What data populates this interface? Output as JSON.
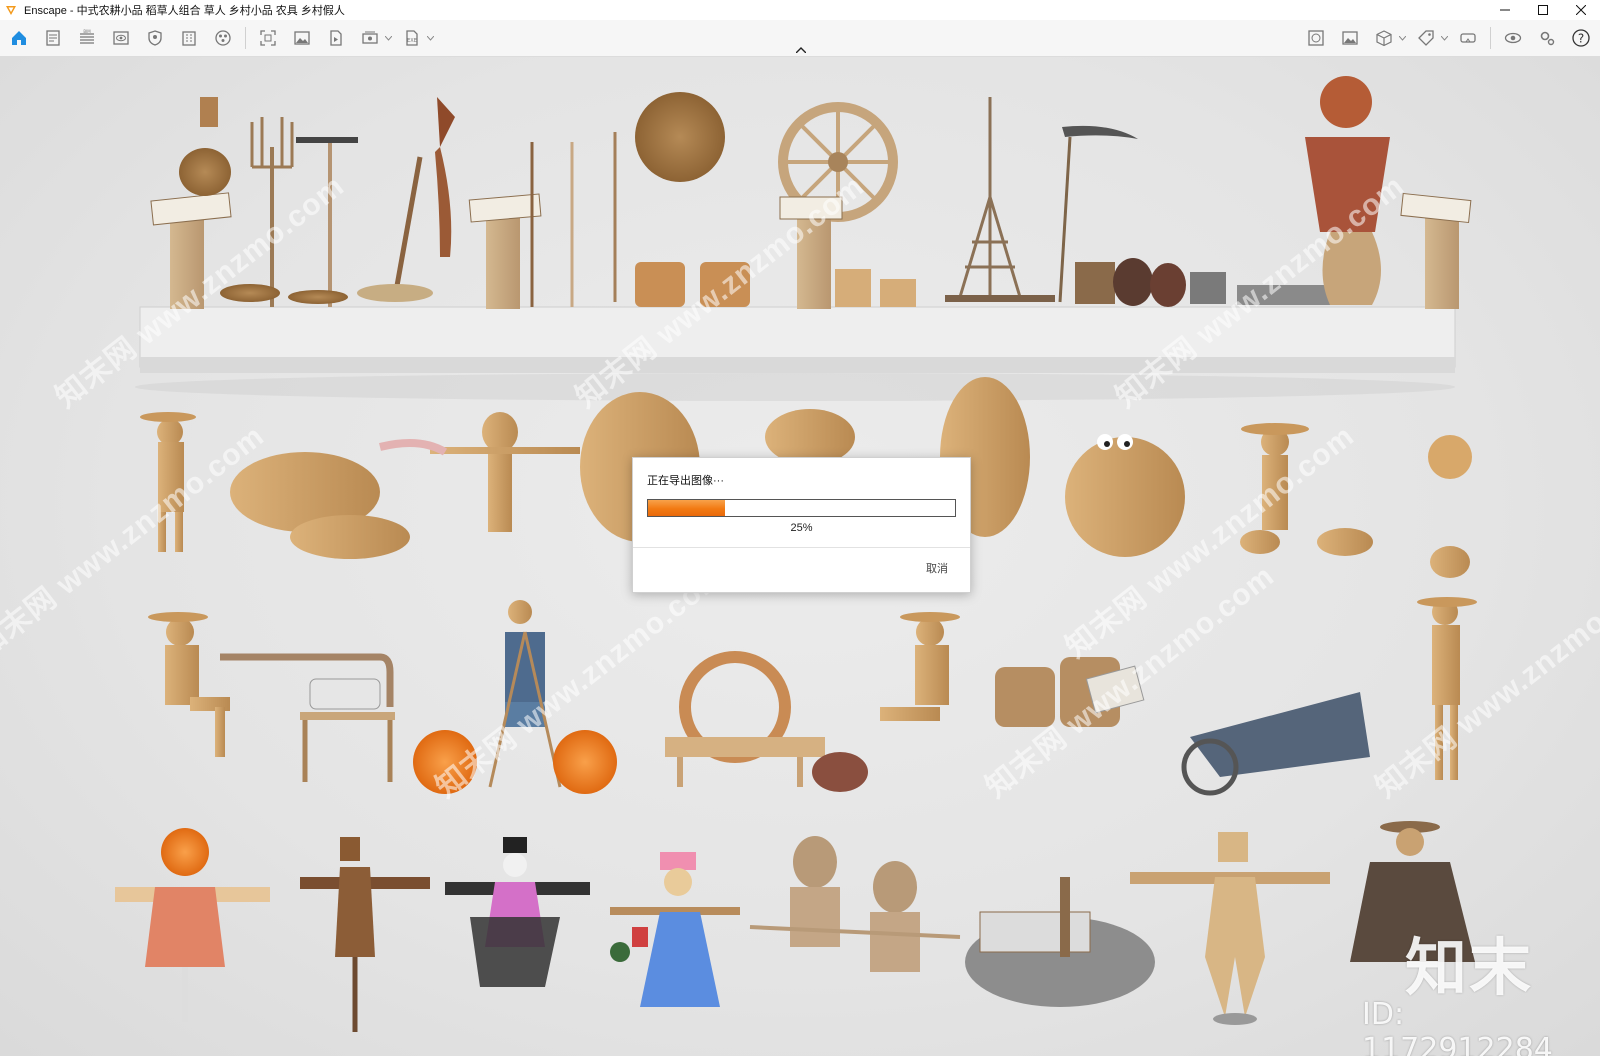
{
  "window": {
    "title": "Enscape - 中式农耕小品 稻草人组合 草人 乡村小品 农具 乡村假人"
  },
  "toolbar": {
    "left_icons": [
      "home-icon",
      "document-icon",
      "bim-icon",
      "eye-view-icon",
      "shield-icon",
      "building-icon",
      "asset-library-icon",
      "screenshot-icon",
      "image-icon",
      "video-file-icon",
      "panorama-icon",
      "exe-export-icon"
    ],
    "right_icons": [
      "material-editor-icon",
      "image-gallery-icon",
      "cube-icon",
      "tag-icon",
      "vr-headset-icon",
      "visibility-icon",
      "settings-icon",
      "help-icon"
    ]
  },
  "export_dialog": {
    "title": "正在导出图像···",
    "progress": 0.25,
    "progress_label": "25%",
    "cancel_label": "取消"
  },
  "watermark": {
    "site_text": "知末网 www.znzmo.com",
    "brand": "知末",
    "id_label": "ID: 1172912284"
  },
  "colors": {
    "accent": "#f27a12",
    "home_blue": "#1f8de0",
    "logo_orange": "#f39a1c"
  }
}
